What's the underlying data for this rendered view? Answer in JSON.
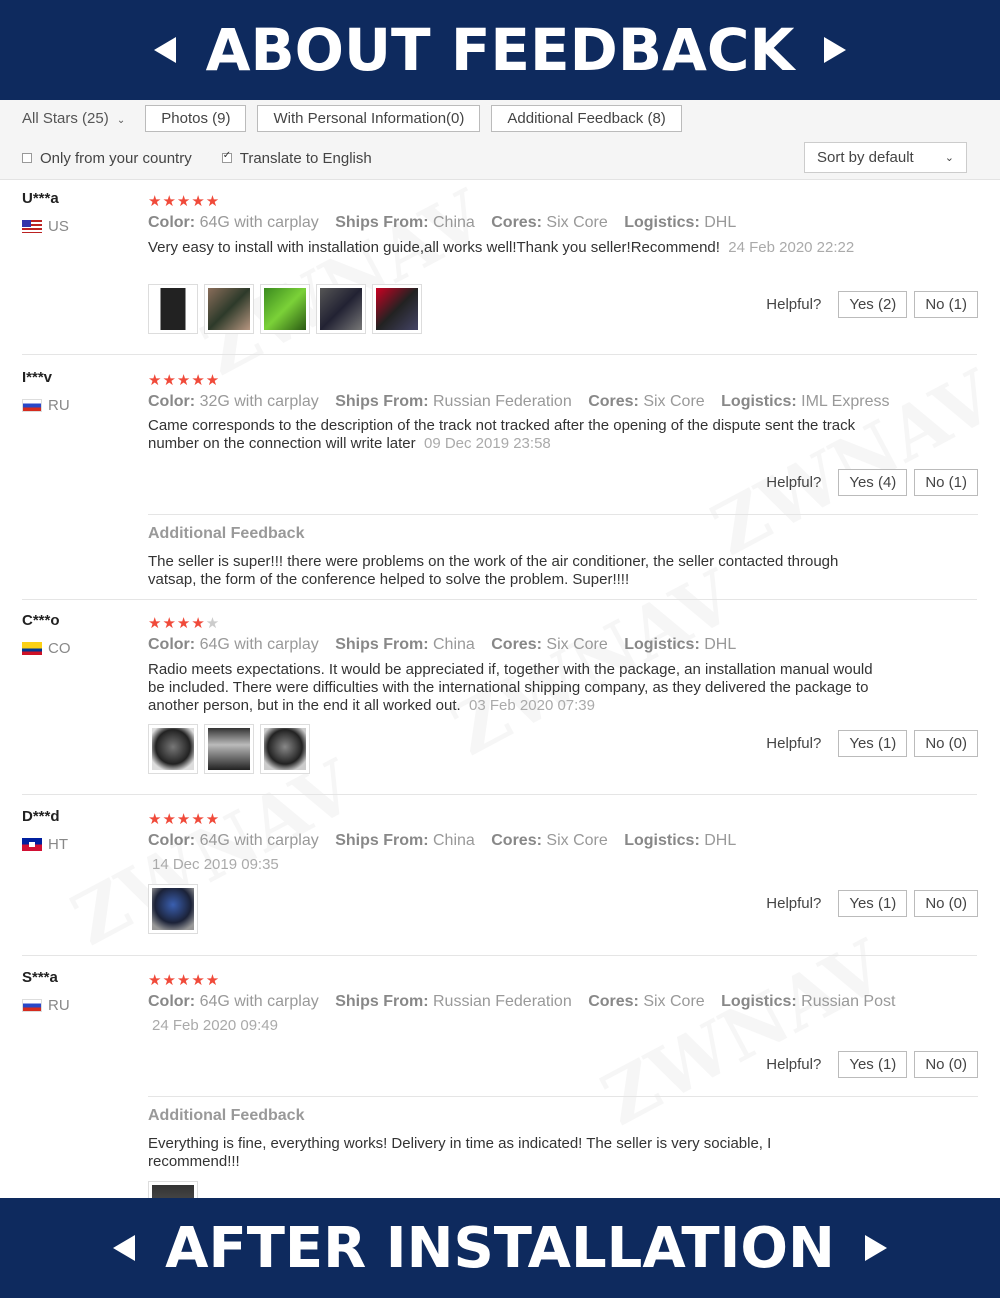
{
  "banner_top": "ABOUT FEEDBACK",
  "banner_bottom": "AFTER INSTALLATION",
  "filters": {
    "all_stars": "All Stars (25)",
    "photos": "Photos (9)",
    "personal_info": "With Personal Information(0)",
    "additional": "Additional Feedback (8)",
    "only_country": "Only from your country",
    "translate": "Translate to English",
    "sort": "Sort by default"
  },
  "watermark": "ZWNAV",
  "attr_labels": {
    "color": "Color:",
    "ships": "Ships From:",
    "cores": "Cores:",
    "logistics": "Logistics:"
  },
  "helpful_label": "Helpful?",
  "additional_title": "Additional Feedback",
  "reviews": [
    {
      "user": "U***a",
      "country": "US",
      "stars": 5,
      "color": "64G with carplay",
      "ships": "China",
      "cores": "Six Core",
      "logistics": "DHL",
      "text": "Very easy to install with installation guide,all works well!Thank you seller!Recommend!",
      "date": "24 Feb 2020 22:22",
      "yes": "Yes (2)",
      "no": "No (1)"
    },
    {
      "user": "I***v",
      "country": "RU",
      "stars": 5,
      "color": "32G with carplay",
      "ships": "Russian Federation",
      "cores": "Six Core",
      "logistics": "IML Express",
      "text": "Came corresponds to the description of the track not tracked after the opening of the dispute sent the track number on the connection will write later",
      "date": "09 Dec 2019 23:58",
      "yes": "Yes (4)",
      "no": "No (1)",
      "additional": "The seller is super!!! there were problems on the work of the air conditioner, the seller contacted through vatsap, the form of the conference helped to solve the problem. Super!!!!"
    },
    {
      "user": "C***o",
      "country": "CO",
      "stars": 4,
      "color": "64G with carplay",
      "ships": "China",
      "cores": "Six Core",
      "logistics": "DHL",
      "text": "Radio meets expectations. It would be appreciated if, together with the package, an installation manual would be included. There were difficulties with the international shipping company, as they delivered the package to another person, but in the end it all worked out.",
      "date": "03 Feb 2020 07:39",
      "yes": "Yes (1)",
      "no": "No (0)"
    },
    {
      "user": "D***d",
      "country": "HT",
      "stars": 5,
      "color": "64G with carplay",
      "ships": "China",
      "cores": "Six Core",
      "logistics": "DHL",
      "date": "14 Dec 2019 09:35",
      "yes": "Yes (1)",
      "no": "No (0)"
    },
    {
      "user": "S***a",
      "country": "RU",
      "stars": 5,
      "color": "64G with carplay",
      "ships": "Russian Federation",
      "cores": "Six Core",
      "logistics": "Russian Post",
      "date": "24 Feb 2020 09:49",
      "yes": "Yes (1)",
      "no": "No (0)",
      "additional": "Everything is fine, everything works! Delivery in time as indicated! The seller is very sociable, I recommend!!!"
    }
  ]
}
